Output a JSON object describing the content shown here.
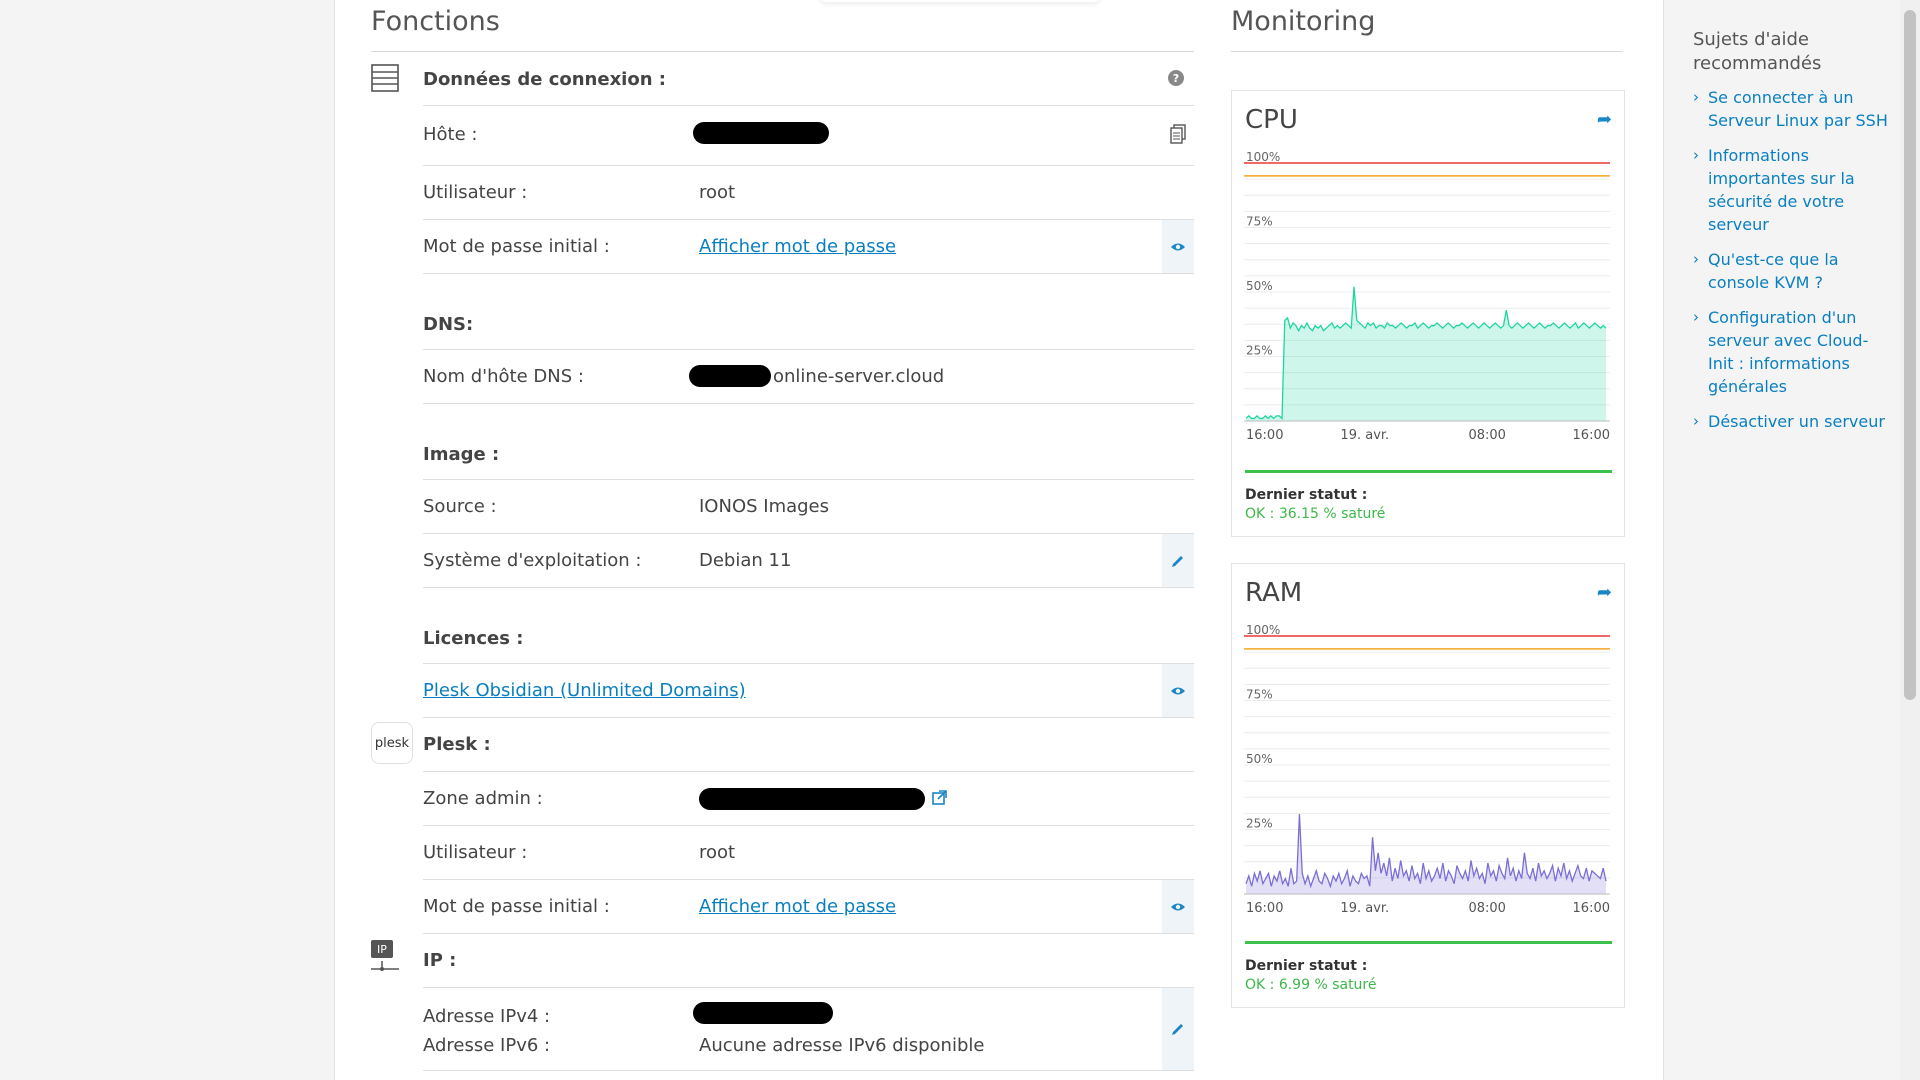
{
  "functions": {
    "title": "Fonctions",
    "connection": {
      "heading": "Données de connexion :",
      "help_icon": "question-icon",
      "host_label": "Hôte :",
      "user_label": "Utilisateur :",
      "user_value": "root",
      "password_label": "Mot de passe initial :",
      "password_link": "Afficher mot de passe"
    },
    "dns": {
      "heading": "DNS:",
      "hostname_label": "Nom d'hôte DNS :",
      "hostname_suffix": "online-server.cloud"
    },
    "image": {
      "heading": "Image :",
      "source_label": "Source :",
      "source_value": "IONOS Images",
      "os_label": "Système d'exploitation :",
      "os_value": "Debian 11"
    },
    "licences": {
      "heading": "Licences :",
      "plesk_link": "Plesk Obsidian (Unlimited Domains)"
    },
    "plesk": {
      "logo_text": "plesk",
      "heading": "Plesk :",
      "admin_label": "Zone admin :",
      "user_label": "Utilisateur :",
      "user_value": "root",
      "password_label": "Mot de passe initial :",
      "password_link": "Afficher mot de passe"
    },
    "ip": {
      "logo_text": "IP",
      "heading": "IP :",
      "ipv4_label": "Adresse IPv4 :",
      "ipv6_label": "Adresse IPv6 :",
      "ipv6_value": "Aucune adresse IPv6 disponible"
    }
  },
  "monitoring": {
    "title": "Monitoring",
    "cpu": {
      "title": "CPU",
      "status_label": "Dernier statut :",
      "status_value": "OK : 36.15 % saturé"
    },
    "ram": {
      "title": "RAM",
      "status_label": "Dernier statut :",
      "status_value": "OK : 6.99 % saturé"
    }
  },
  "chart_data": [
    {
      "type": "area",
      "ylim": [
        0,
        100
      ],
      "yticks": [
        "100%",
        "75%",
        "50%",
        "25%"
      ],
      "x_ticks": [
        "16:00",
        "19. avr.",
        "08:00",
        "16:00"
      ],
      "thresholds": [
        {
          "value": 100,
          "color": "#e53935"
        },
        {
          "value": 95,
          "color": "#f5a623"
        }
      ],
      "color": "#1fd6a0",
      "values": [
        1,
        2,
        1,
        1,
        2,
        1,
        1,
        2,
        1,
        2,
        1,
        2,
        2,
        1,
        39,
        40,
        36,
        38,
        37,
        35,
        37,
        36,
        38,
        36,
        35,
        37,
        36,
        37,
        35,
        36,
        37,
        38,
        36,
        37,
        36,
        37,
        38,
        37,
        36,
        52,
        39,
        38,
        37,
        36,
        38,
        37,
        38,
        36,
        37,
        37,
        36,
        38,
        37,
        37,
        36,
        37,
        38,
        37,
        36,
        37,
        37,
        38,
        36,
        37,
        38,
        37,
        36,
        37,
        37,
        38,
        37,
        36,
        37,
        38,
        37,
        36,
        37,
        37,
        38,
        37,
        36,
        37,
        38,
        37,
        36,
        37,
        38,
        37,
        36,
        37,
        38,
        37,
        36,
        37,
        43,
        37,
        36,
        37,
        38,
        37,
        36,
        37,
        38,
        37,
        36,
        37,
        38,
        37,
        36,
        37,
        37,
        38,
        37,
        36,
        37,
        38,
        37,
        36,
        37,
        38,
        36,
        37,
        38,
        37,
        36,
        37,
        38,
        37,
        36,
        37,
        36
      ]
    },
    {
      "type": "area",
      "ylim": [
        0,
        100
      ],
      "yticks": [
        "100%",
        "75%",
        "50%",
        "25%"
      ],
      "x_ticks": [
        "16:00",
        "19. avr.",
        "08:00",
        "16:00"
      ],
      "thresholds": [
        {
          "value": 100,
          "color": "#e53935"
        },
        {
          "value": 95,
          "color": "#f5a623"
        }
      ],
      "color": "#7b6fd6",
      "values": [
        4,
        7,
        3,
        8,
        5,
        9,
        4,
        6,
        8,
        3,
        7,
        5,
        9,
        4,
        6,
        3,
        10,
        4,
        5,
        31,
        8,
        4,
        7,
        3,
        6,
        9,
        5,
        4,
        8,
        6,
        3,
        7,
        5,
        8,
        4,
        6,
        9,
        3,
        7,
        5,
        4,
        8,
        6,
        7,
        3,
        22,
        9,
        16,
        8,
        12,
        7,
        14,
        5,
        10,
        6,
        13,
        7,
        9,
        5,
        11,
        6,
        8,
        4,
        12,
        6,
        9,
        5,
        7,
        10,
        6,
        12,
        5,
        9,
        7,
        4,
        11,
        8,
        6,
        9,
        5,
        13,
        7,
        10,
        6,
        8,
        4,
        12,
        7,
        9,
        5,
        11,
        8,
        6,
        14,
        7,
        10,
        5,
        9,
        6,
        16,
        8,
        6,
        10,
        5,
        12,
        7,
        9,
        6,
        8,
        11,
        5,
        10,
        7,
        12,
        6,
        9,
        5,
        8,
        11,
        7,
        6,
        10,
        5,
        9,
        8,
        7,
        6,
        10,
        5
      ]
    }
  ],
  "help": {
    "title": "Sujets d'aide recommandés",
    "items": [
      "Se connecter à un Serveur Linux par SSH",
      "Informations importantes sur la sécurité de votre serveur",
      "Qu'est-ce que la console KVM ?",
      "Configuration d'un serveur avec Cloud-Init : informations générales",
      "Désactiver un serveur"
    ]
  }
}
